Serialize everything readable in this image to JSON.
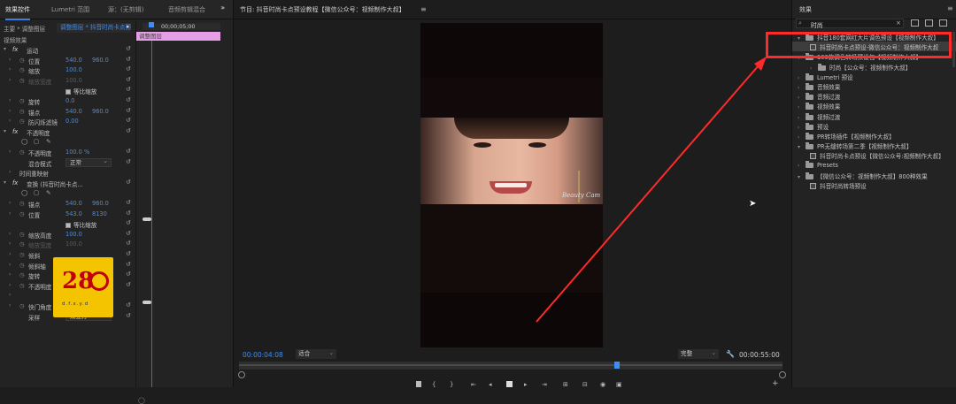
{
  "left_panel": {
    "tabs": [
      {
        "label": "效果控件",
        "active": true
      },
      {
        "label": "Lumetri 范围",
        "active": false
      },
      {
        "label": "源：(无剪辑)",
        "active": false
      },
      {
        "label": "音频剪辑混合",
        "active": false
      }
    ],
    "overflow_glyph": "»",
    "menu_glyph": "≡",
    "master_label": "主要 * 调整图层",
    "clip_label": "调整图层 * 抖音时尚卡点预...",
    "timeline_time": "00;00;05;00",
    "clip_block_label": "调整图层",
    "section_title": "视频效果",
    "rows": [
      {
        "kind": "fx",
        "label": "运动",
        "indent": 1
      },
      {
        "kind": "prop",
        "label": "位置",
        "v1": "540.0",
        "v2": "960.0"
      },
      {
        "kind": "prop",
        "label": "缩放",
        "v1": "100.0"
      },
      {
        "kind": "prop",
        "label": "缩放宽度",
        "v1": "100.0",
        "dim": true
      },
      {
        "kind": "check",
        "label": "等比缩放"
      },
      {
        "kind": "prop",
        "label": "旋转",
        "v1": "0.0"
      },
      {
        "kind": "prop",
        "label": "锚点",
        "v1": "540.0",
        "v2": "960.0"
      },
      {
        "kind": "prop",
        "label": "防闪烁滤镜",
        "v1": "0.00"
      },
      {
        "kind": "fx",
        "label": "不透明度"
      },
      {
        "kind": "masks"
      },
      {
        "kind": "prop",
        "label": "不透明度",
        "v1": "100.0 %"
      },
      {
        "kind": "select",
        "label": "混合模式",
        "value": "正常"
      },
      {
        "kind": "plain",
        "label": "时间重映射"
      },
      {
        "kind": "fx",
        "label": "变换 (抖音时尚卡点..."
      },
      {
        "kind": "masks"
      },
      {
        "kind": "prop",
        "label": "锚点",
        "v1": "540.0",
        "v2": "960.0"
      },
      {
        "kind": "prop",
        "label": "位置",
        "v1": "543.0",
        "v2": "8130"
      },
      {
        "kind": "check",
        "label": "等比缩放"
      },
      {
        "kind": "prop",
        "label": "缩放高度",
        "v1": "100.0"
      },
      {
        "kind": "prop",
        "label": "缩放宽度",
        "v1": "100.0",
        "dim": true
      },
      {
        "kind": "prop",
        "label": "倾斜",
        "v1": ""
      },
      {
        "kind": "prop",
        "label": "倾斜轴",
        "v1": ""
      },
      {
        "kind": "prop",
        "label": "旋转",
        "v1": ""
      },
      {
        "kind": "prop",
        "label": "不透明度",
        "v1": ""
      },
      {
        "kind": "plain",
        "label": ""
      },
      {
        "kind": "prop",
        "label": "快门角度",
        "v1": ""
      },
      {
        "kind": "select",
        "label": "采样",
        "value": "双立方"
      }
    ]
  },
  "watermark": {
    "number": "28",
    "sub": "d.f.x.y.d"
  },
  "program": {
    "title": "节目: 抖音时尚卡点预设教程【微信公众号：视频制作大叔】",
    "menu_glyph": "≡",
    "timecode": "00:00:04:08",
    "fit_label": "适合",
    "quality_label": "完整",
    "duration": "00:00:55:00",
    "photo_signature": "Beauty Cam"
  },
  "effects_panel": {
    "title": "效果",
    "menu_glyph": "≡",
    "search_value": "时尚",
    "items": [
      {
        "label": "抖音180套网红大片调色预设【视频制作大叔】",
        "type": "folder",
        "indent": 0,
        "open": true
      },
      {
        "label": "抖音时尚卡点预设-微信公众号：视频制作大叔",
        "type": "preset",
        "indent": 1,
        "selected": true
      },
      {
        "label": "100款调色转场预设包【视频制作大叔】",
        "type": "folder",
        "indent": 0,
        "open": true
      },
      {
        "label": "时尚【公众号：视频制作大叔】",
        "type": "folder",
        "indent": 1,
        "open": false
      },
      {
        "label": "Lumetri 预设",
        "type": "folder",
        "indent": 0
      },
      {
        "label": "音频效果",
        "type": "folder",
        "indent": 0
      },
      {
        "label": "音频过渡",
        "type": "folder",
        "indent": 0
      },
      {
        "label": "视频效果",
        "type": "folder",
        "indent": 0
      },
      {
        "label": "视频过渡",
        "type": "folder",
        "indent": 0
      },
      {
        "label": "预设",
        "type": "folder",
        "indent": 0
      },
      {
        "label": "PR转场插件【视频制作大叔】",
        "type": "folder",
        "indent": 0
      },
      {
        "label": "PR无缝转场第二季【视频制作大叔】",
        "type": "folder",
        "indent": 0,
        "open": true
      },
      {
        "label": "抖音时尚卡点预设【微信公众号:视频制作大叔】",
        "type": "preset",
        "indent": 1
      },
      {
        "label": "Presets",
        "type": "folder",
        "indent": 0
      },
      {
        "label": "【微信公众号：视频制作大叔】800种效果",
        "type": "folder",
        "indent": 0,
        "open": true
      },
      {
        "label": "抖音时尚转场预设",
        "type": "preset",
        "indent": 1
      }
    ]
  },
  "colors": {
    "accent": "#3e8ef7",
    "highlight": "#ff2a2a",
    "clip": "#e69fe6"
  }
}
